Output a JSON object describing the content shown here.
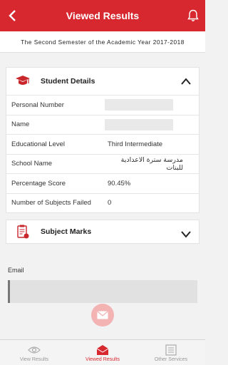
{
  "header": {
    "title": "Viewed Results"
  },
  "semester": "The Second Semester of the Academic Year 2017-2018",
  "student_details": {
    "title": "Student Details",
    "rows": [
      {
        "label": "Personal Number",
        "value": ""
      },
      {
        "label": "Name",
        "value": ""
      },
      {
        "label": "Educational Level",
        "value": "Third Intermediate"
      },
      {
        "label": "School Name",
        "value": "مدرسة سترة الاعدادية للبنات"
      },
      {
        "label": "Percentage Score",
        "value": "90.45%"
      },
      {
        "label": "Number of Subjects Failed",
        "value": "0"
      }
    ]
  },
  "subject_marks": {
    "title": "Subject Marks"
  },
  "email": {
    "label": "Email",
    "value": ""
  },
  "tabs": [
    {
      "label": "View Results",
      "active": false
    },
    {
      "label": "Viewed Results",
      "active": true
    },
    {
      "label": "Other Services",
      "active": false
    }
  ],
  "colors": {
    "brand": "#d7282f",
    "fab": "#f3b3b3"
  }
}
